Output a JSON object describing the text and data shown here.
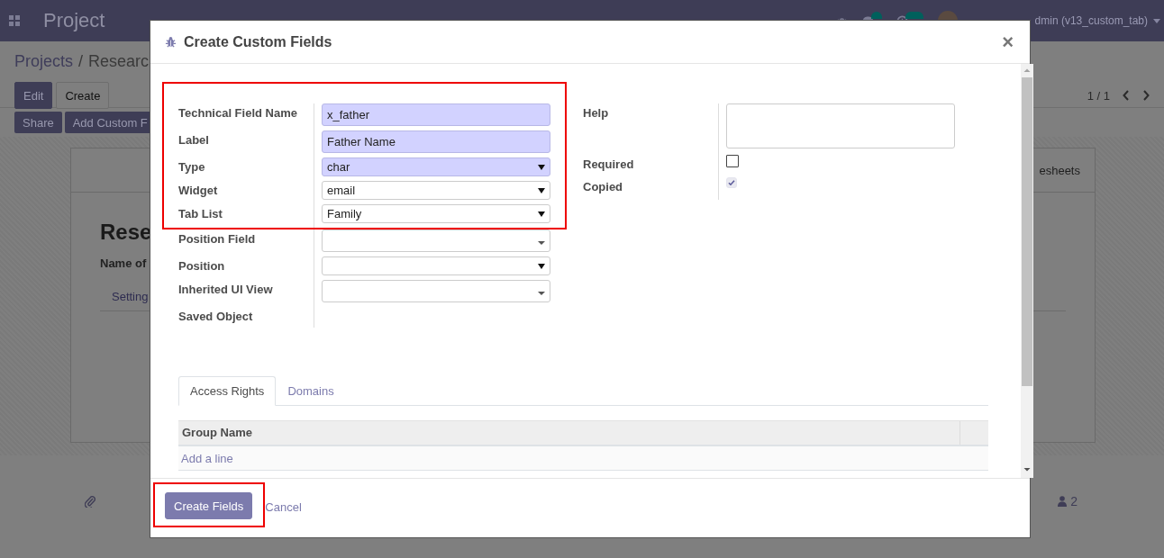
{
  "navbar": {
    "app_title": "Project",
    "user": "dmin (v13_custom_tab)"
  },
  "control_panel": {
    "breadcrumb": [
      "Projects",
      "Researc"
    ],
    "breadcrumb_separator": "/",
    "buttons": [
      {
        "label": "Edit",
        "kind": "primary"
      },
      {
        "label": "Create",
        "kind": "secondary"
      }
    ],
    "actions": [
      "Share",
      "Add Custom F"
    ],
    "pager": "1 / 1"
  },
  "sheet": {
    "title": "Rese",
    "name_label": "Name of",
    "tab": "Setting",
    "button_box_label": "esheets"
  },
  "chatter": {
    "followers": "2"
  },
  "dialog": {
    "title": "Create Custom Fields",
    "close_symbol": "×",
    "left_fields": [
      {
        "label": "Technical Field Name",
        "kind": "text",
        "value": "x_father",
        "required": true,
        "highlighted": true
      },
      {
        "label": "Label",
        "kind": "text",
        "value": "Father Name",
        "required": true,
        "highlighted": true
      },
      {
        "label": "Type",
        "kind": "select",
        "value": "char",
        "required": true,
        "highlighted": true
      },
      {
        "label": "Widget",
        "kind": "select",
        "value": "email",
        "required": false,
        "highlighted": true
      },
      {
        "label": "Tab List",
        "kind": "select",
        "value": "Family",
        "required": false,
        "highlighted": true
      },
      {
        "label": "Position Field",
        "kind": "many2one",
        "required": false,
        "highlighted": false
      },
      {
        "label": "Position",
        "kind": "select",
        "required": false,
        "highlighted": false
      },
      {
        "label": "Inherited UI View",
        "kind": "many2one",
        "required": false,
        "highlighted": false
      },
      {
        "label": "Saved Object",
        "kind": "none",
        "highlighted": false
      }
    ],
    "right_fields": [
      {
        "label": "Help",
        "kind": "textarea"
      },
      {
        "label": "Required",
        "kind": "checkbox",
        "checked": false,
        "disabled": false
      },
      {
        "label": "Copied",
        "kind": "checkbox",
        "checked": true,
        "disabled": true
      }
    ],
    "tabs": [
      {
        "label": "Access Rights",
        "selected": true
      },
      {
        "label": "Domains",
        "selected": false
      }
    ],
    "table": {
      "columns": [
        "Group Name"
      ],
      "add_line": "Add a line"
    },
    "buttons": [
      {
        "label": "Create Fields",
        "kind": "primary",
        "highlighted": true
      },
      {
        "label": "Cancel",
        "kind": "link",
        "highlighted": false
      }
    ]
  }
}
